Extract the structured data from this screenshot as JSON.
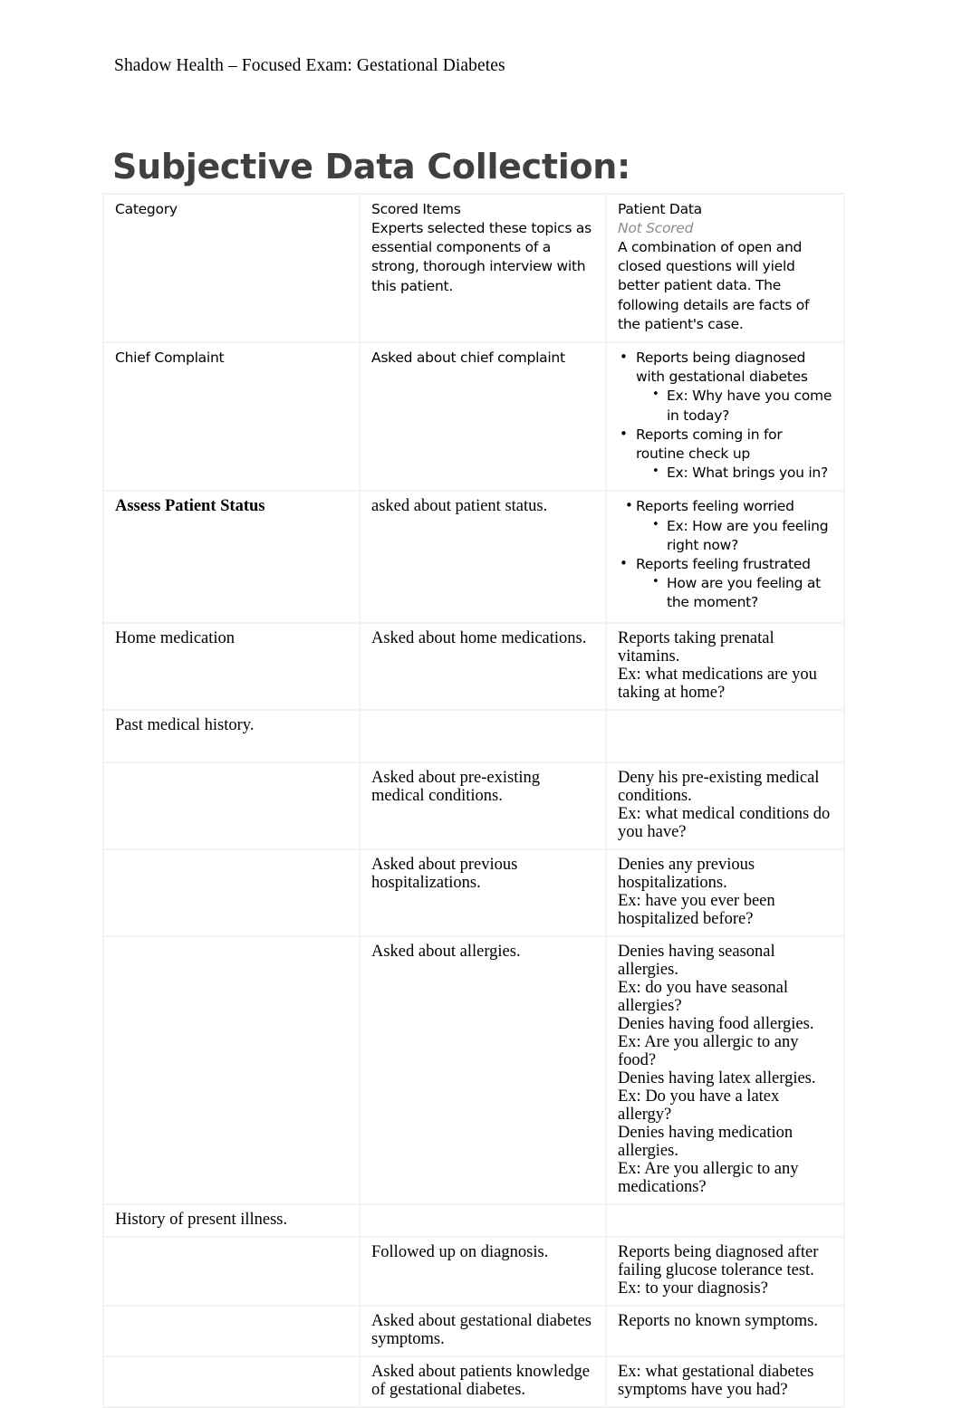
{
  "document": {
    "running_header": "Shadow Health – Focused Exam: Gestational Diabetes",
    "title": "Subjective Data Collection:"
  },
  "table": {
    "columns": [
      {
        "id": "category",
        "header": "Category"
      },
      {
        "id": "scored_items",
        "header": "Scored Items"
      },
      {
        "id": "patient_data",
        "header": "Patient Data"
      }
    ],
    "header_row": {
      "category": "Category",
      "scored_items_title": "Scored Items",
      "scored_items_desc": "Experts selected these topics as essential components of a strong, thorough interview with this patient.",
      "patient_data_title": "Patient Data",
      "patient_data_sub": "Not Scored",
      "patient_data_desc": "A combination of open and closed questions will yield better patient data. The following details are facts of the patient's case."
    },
    "rows": [
      {
        "category": "Chief Complaint",
        "scored_item": "Asked about chief complaint",
        "patient_bullets": [
          {
            "text": "Reports being diagnosed with gestational diabetes",
            "sub": [
              "Ex: Why have you come in today?"
            ]
          },
          {
            "text": "Reports coming in for routine check up",
            "sub": [
              "Ex: What brings you in?"
            ]
          }
        ]
      },
      {
        "category": "Assess Patient Status",
        "category_bold": true,
        "scored_item": "asked about patient status.",
        "patient_bullets": [
          {
            "text": "Reports feeling worried",
            "tight": true,
            "sub": [
              "Ex: How are you feeling right now?"
            ]
          },
          {
            "text": "Reports feeling frustrated",
            "sub": [
              "How are you feeling at the moment?"
            ]
          }
        ]
      },
      {
        "category": "Home medication",
        "scored_item": "Asked about home medications.",
        "patient_lines": [
          "Reports taking prenatal vitamins.",
          "Ex: what medications are you taking at home?"
        ]
      },
      {
        "category": "Past medical history.",
        "scored_item": "",
        "patient_lines": []
      },
      {
        "category": "",
        "scored_item": "Asked about pre-existing medical conditions.",
        "patient_lines": [
          "Deny his pre-existing medical conditions.",
          "Ex: what medical conditions do you have?"
        ]
      },
      {
        "category": "",
        "scored_item": "Asked about previous hospitalizations.",
        "patient_lines": [
          "Denies any previous hospitalizations.",
          "Ex: have you ever been hospitalized before?"
        ]
      },
      {
        "category": "",
        "scored_item": "Asked about allergies.",
        "patient_lines": [
          "Denies having seasonal allergies.",
          "Ex: do you have seasonal allergies?",
          "Denies having food allergies.",
          "Ex: Are you allergic to any food?",
          "Denies having latex allergies.",
          "Ex: Do you have a latex allergy?",
          "Denies having medication allergies.",
          "Ex: Are you allergic to any medications?"
        ]
      },
      {
        "category": "History of present illness.",
        "scored_item": "",
        "patient_lines": []
      },
      {
        "category": "",
        "scored_item": "Followed up on diagnosis.",
        "patient_lines": [
          "Reports being diagnosed after failing glucose tolerance test.",
          "Ex: to your diagnosis?"
        ]
      },
      {
        "category": "",
        "scored_item": "Asked about gestational diabetes symptoms.",
        "patient_lines": [
          "Reports no known symptoms."
        ]
      },
      {
        "category": "",
        "scored_item": "Asked about patients knowledge of gestational diabetes.",
        "patient_lines": [
          "Ex: what gestational diabetes symptoms have you had?"
        ]
      }
    ]
  },
  "colors": {
    "title": "#404040",
    "body_text": "#000000",
    "muted": "#8c8c8c",
    "grid_line": "#f2f2f2"
  }
}
